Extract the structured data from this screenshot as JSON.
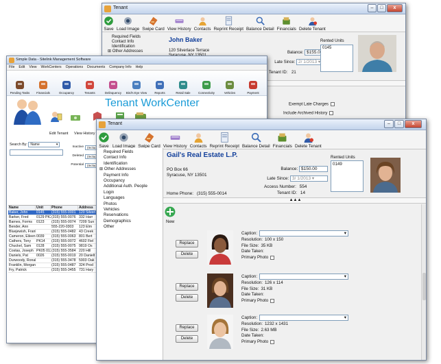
{
  "back_window": {
    "title": "Tenant",
    "toolbar": [
      "Save",
      "Load Image",
      "Swipe Card",
      "View History",
      "Contacts",
      "Reprint Receipt",
      "Balance Detail",
      "Financials",
      "Delete Tenant"
    ],
    "nav": [
      "Required Fields",
      "Contact Info",
      "Identification",
      "Other Addresses"
    ],
    "tenant_name": "John Baker",
    "address": [
      "120 Silverlace Terrace",
      "Syracuse, NY 13501"
    ],
    "balance_label": "Balance:",
    "balance": "$155.00",
    "late_since_label": "Late Since:",
    "late_since": "2/ 1/2013",
    "tenant_id_label": "Tenant ID:",
    "tenant_id": "21",
    "rented_units_label": "Rented Units",
    "rented_unit": "0145",
    "exempt_label": "Exempt Late Charges",
    "archived_label": "Include Archived History"
  },
  "middle_window": {
    "title": "Simple Data - Sitelink Management Software",
    "menu": [
      "File",
      "Edit",
      "View",
      "WorkCenters",
      "Operations",
      "Documents",
      "Company Info",
      "Help"
    ],
    "nav_buttons": [
      "Pending Tasks",
      "Financials",
      "Occupancy",
      "Tenants",
      "Delinquency",
      "Bird's Eye View",
      "Reports",
      "Retail Sale",
      "Connectivity",
      "Vehicles",
      "Payment"
    ],
    "workcenter_title": "Tenant WorkCenter",
    "sub_actions": [
      "Edit Tenant",
      "View History"
    ],
    "hint": "Click a column header to sort by that column. Use the asterisk (*) wildcard character to find more results.",
    "search_by_label": "Search By:",
    "search_by_value": "Name",
    "filters": [
      "Inactive",
      "Deleted",
      "Potential"
    ],
    "include_labels": [
      "(Include)",
      "(Include)",
      "(Include)"
    ],
    "columns": [
      "Name",
      "Unit",
      "Phone",
      "Address"
    ],
    "rows": [
      [
        "Baker, John",
        "0145",
        "(315) 555-0001",
        "120 Silverl"
      ],
      [
        "Barker, Fred",
        "0129 PK20",
        "(315) 555-0076",
        "332 Harr"
      ],
      [
        "Barnes, Forms",
        "0123",
        "(315) 555-0074",
        "7209 Sun"
      ],
      [
        "Bender, Ann",
        "",
        "555-220-0303",
        "123 Elm"
      ],
      [
        "Bluejewish, Franklin",
        "",
        "(315) 555-0482",
        "43 Creek"
      ],
      [
        "Cameron, Eileen",
        "0039",
        "(315) 555-0063",
        "801 Bert"
      ],
      [
        "Cathers, Tony",
        "PK14",
        "(315) 555-0072",
        "4602 Fiel"
      ],
      [
        "Chuckel, Sam",
        "0128",
        "(315) 555-0075",
        "9819 Os"
      ],
      [
        "Costas, Joseph",
        "PK05 0125",
        "(315) 555-3584",
        "220 Hill"
      ],
      [
        "Daniels, Pat",
        "0026",
        "(315) 555-0019",
        "20 Danielt"
      ],
      [
        "Durwoody, Ronald",
        "",
        "(315) 555-3478",
        "5903 Oak"
      ],
      [
        "Franklin, Morgan",
        "",
        "(315) 555-0487",
        "324 Prod"
      ],
      [
        "Fry, Patrick",
        "",
        "(315) 555-3455",
        "731 Hary"
      ]
    ]
  },
  "front_window": {
    "title": "Tenant",
    "toolbar": [
      "Save",
      "Load Image",
      "Swipe Card",
      "View History",
      "Contacts",
      "Reprint Receipt",
      "Balance Detail",
      "Financials",
      "Delete Tenant"
    ],
    "nav": [
      {
        "label": "Required Fields",
        "expander": false
      },
      {
        "label": "Contact Info",
        "expander": false
      },
      {
        "label": "Identification",
        "expander": false
      },
      {
        "label": "Other Addresses",
        "expander": true
      },
      {
        "label": "Payment Info",
        "expander": false
      },
      {
        "label": "Occupancy",
        "expander": false
      },
      {
        "label": "Additional Auth. People",
        "expander": false
      },
      {
        "label": "Login",
        "expander": false
      },
      {
        "label": "Languages",
        "expander": false
      },
      {
        "label": "Photos",
        "expander": false
      },
      {
        "label": "Vehicles",
        "expander": false
      },
      {
        "label": "Reservations",
        "expander": false
      },
      {
        "label": "Demographics",
        "expander": false
      },
      {
        "label": "Other",
        "expander": false
      }
    ],
    "tenant_name": "Gail's Real Estate L.P.",
    "address": [
      "PO Box 66",
      "Syracuse, NY  13501"
    ],
    "balance_label": "Balance:",
    "balance": "$150.00",
    "late_since_label": "Late Since:",
    "late_since": "3/ 1/2013",
    "access_label": "Access Number:",
    "access_number": "554",
    "tenant_id_label": "Tenant ID:",
    "tenant_id": "14",
    "home_phone_label": "Home Phone:",
    "home_phone": "(315) 555-0014",
    "rented_units_label": "Rented Units",
    "rented_unit": "0149",
    "collapse_glyph": "▲▲▲",
    "new_label": "New",
    "replace_label": "Replace",
    "delete_label": "Delete",
    "caption_label": "Caption:",
    "resolution_label": "Resolution:",
    "file_size_label": "File Size:",
    "date_taken_label": "Date Taken:",
    "primary_label": "Primary Photo",
    "photos": [
      {
        "resolution": "100 x 150",
        "file_size": "35 KB"
      },
      {
        "resolution": "126 x 114",
        "file_size": "31 KB"
      },
      {
        "resolution": "1232 x 1431",
        "file_size": "2.63 MB"
      }
    ]
  },
  "colors": {
    "accent_blue": "#1a9bd7",
    "title_blue": "#13409b",
    "selection": "#3169c6",
    "new_button_green": "#38a852"
  }
}
